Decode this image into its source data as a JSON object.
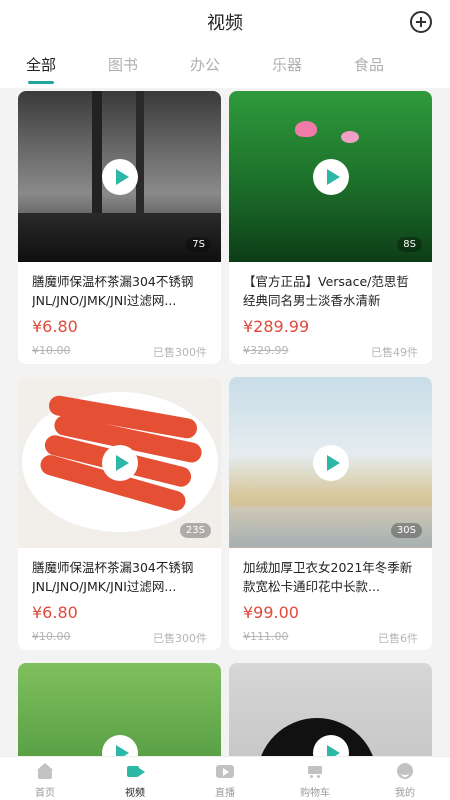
{
  "header": {
    "title": "视频"
  },
  "tabs": [
    "全部",
    "图书",
    "办公",
    "乐器",
    "食品"
  ],
  "cards": [
    {
      "title": "膳魔师保温杯茶漏304不锈钢JNL/JNO/JMK/JNI过滤网...",
      "price": "¥6.80",
      "original": "¥10.00",
      "sold": "已售300件",
      "duration": "7S"
    },
    {
      "title": "【官方正品】Versace/范思哲经典同名男士淡香水清新",
      "price": "¥289.99",
      "original": "¥329.99",
      "sold": "已售49件",
      "duration": "8S"
    },
    {
      "title": "膳魔师保温杯茶漏304不锈钢JNL/JNO/JMK/JNI过滤网...",
      "price": "¥6.80",
      "original": "¥10.00",
      "sold": "已售300件",
      "duration": "23S"
    },
    {
      "title": "加绒加厚卫衣女2021年冬季新款宽松卡通印花中长款...",
      "price": "¥99.00",
      "original": "¥111.00",
      "sold": "已售6件",
      "duration": "30S"
    },
    {
      "title": "",
      "price": "",
      "original": "",
      "sold": "",
      "duration": ""
    },
    {
      "title": "",
      "price": "",
      "original": "",
      "sold": "",
      "duration": ""
    }
  ],
  "bottom_nav": [
    {
      "label": "首页",
      "icon": "home-icon"
    },
    {
      "label": "视频",
      "icon": "video-icon"
    },
    {
      "label": "直播",
      "icon": "live-icon"
    },
    {
      "label": "购物车",
      "icon": "cart-icon"
    },
    {
      "label": "我的",
      "icon": "me-icon"
    }
  ]
}
